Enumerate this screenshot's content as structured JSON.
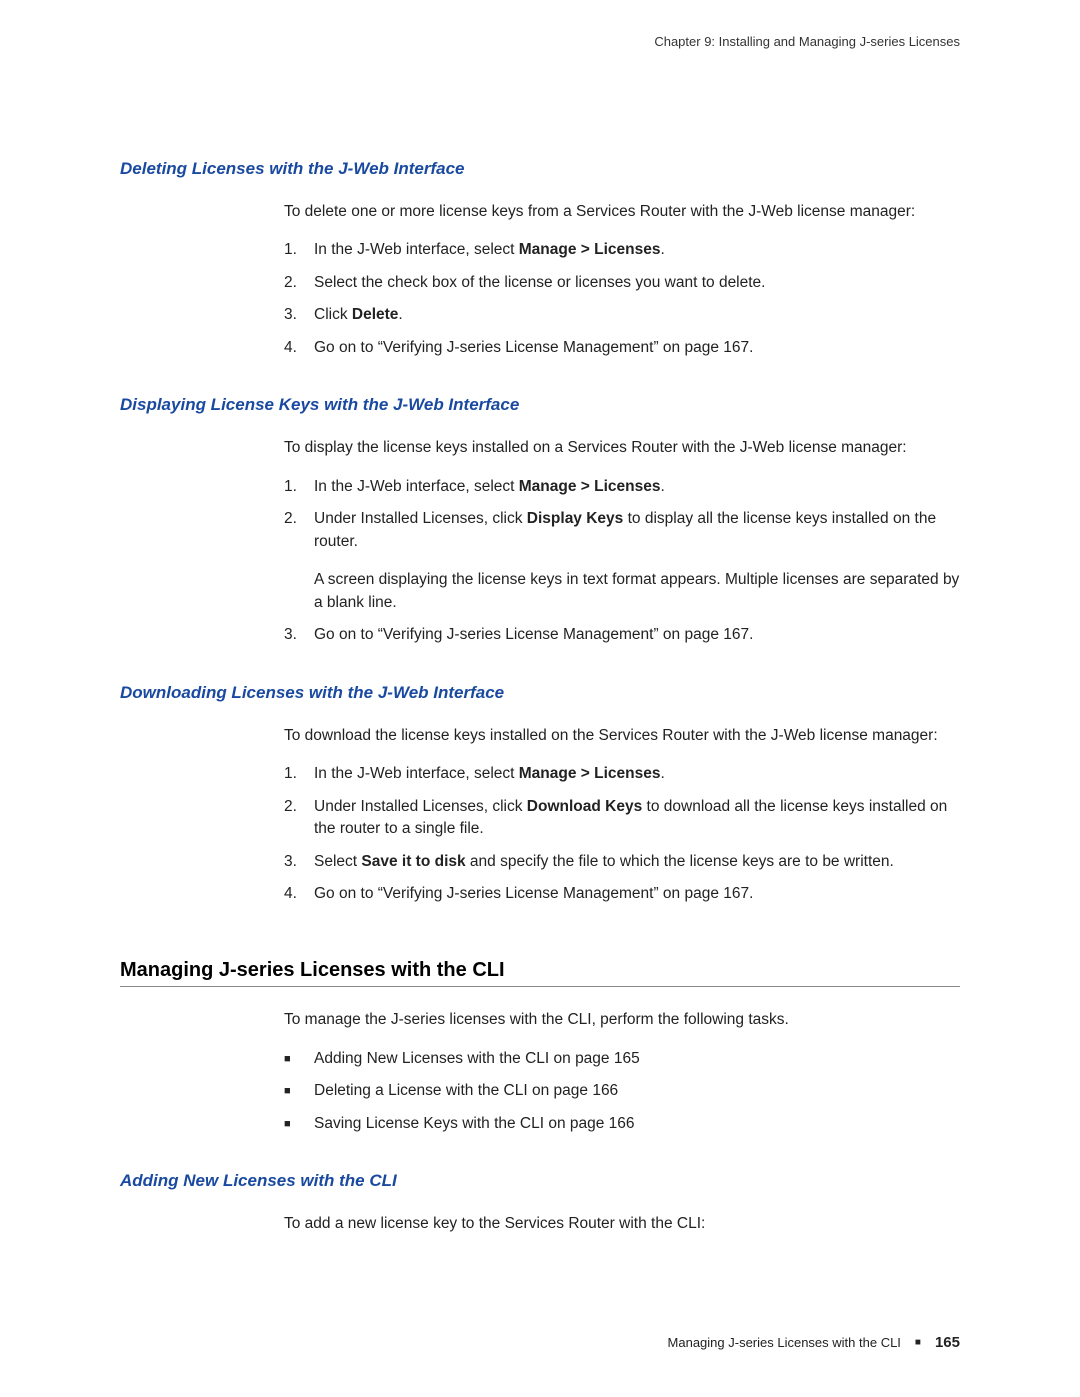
{
  "header": {
    "chapter_line": "Chapter 9: Installing and Managing J-series Licenses"
  },
  "s1": {
    "title": "Deleting Licenses with the J-Web Interface",
    "intro": "To delete one or more license keys from a Services Router with the J-Web license manager:",
    "steps": {
      "a_pre": "In the J-Web interface, select ",
      "a_bold": "Manage > Licenses",
      "a_post": ".",
      "b": "Select the check box of the license or licenses you want to delete.",
      "c_pre": "Click ",
      "c_bold": "Delete",
      "c_post": ".",
      "d": "Go on to “Verifying J-series License Management” on page 167."
    }
  },
  "s2": {
    "title": "Displaying License Keys with the J-Web Interface",
    "intro": "To display the license keys installed on a Services Router with the J-Web license manager:",
    "steps": {
      "a_pre": "In the J-Web interface, select ",
      "a_bold": "Manage > Licenses",
      "a_post": ".",
      "b_pre": "Under Installed Licenses, click ",
      "b_bold": "Display Keys",
      "b_post": " to display all the license keys installed on the router.",
      "b_sub": "A screen displaying the license keys in text format appears. Multiple licenses are separated by a blank line.",
      "c": "Go on to “Verifying J-series License Management” on page 167."
    }
  },
  "s3": {
    "title": "Downloading Licenses with the J-Web Interface",
    "intro": "To download the license keys installed on the Services Router with the J-Web license manager:",
    "steps": {
      "a_pre": "In the J-Web interface, select ",
      "a_bold": "Manage > Licenses",
      "a_post": ".",
      "b_pre": "Under Installed Licenses, click ",
      "b_bold": "Download Keys",
      "b_post": " to download all the license keys installed on the router to a single file.",
      "c_pre": "Select ",
      "c_bold": "Save it to disk",
      "c_post": " and specify the file to which the license keys are to be written.",
      "d": "Go on to “Verifying J-series License Management” on page 167."
    }
  },
  "s4": {
    "title": "Managing J-series Licenses with the CLI",
    "intro": "To manage the J-series licenses with the CLI, perform the following tasks.",
    "bullets": {
      "a": "Adding New Licenses with the CLI on page 165",
      "b": "Deleting a License with the CLI on page 166",
      "c": "Saving License Keys with the CLI on page 166"
    }
  },
  "s5": {
    "title": "Adding New Licenses with the CLI",
    "intro": "To add a new license key to the Services Router with the CLI:"
  },
  "footer": {
    "text": "Managing J-series Licenses with the CLI",
    "page": "165"
  }
}
